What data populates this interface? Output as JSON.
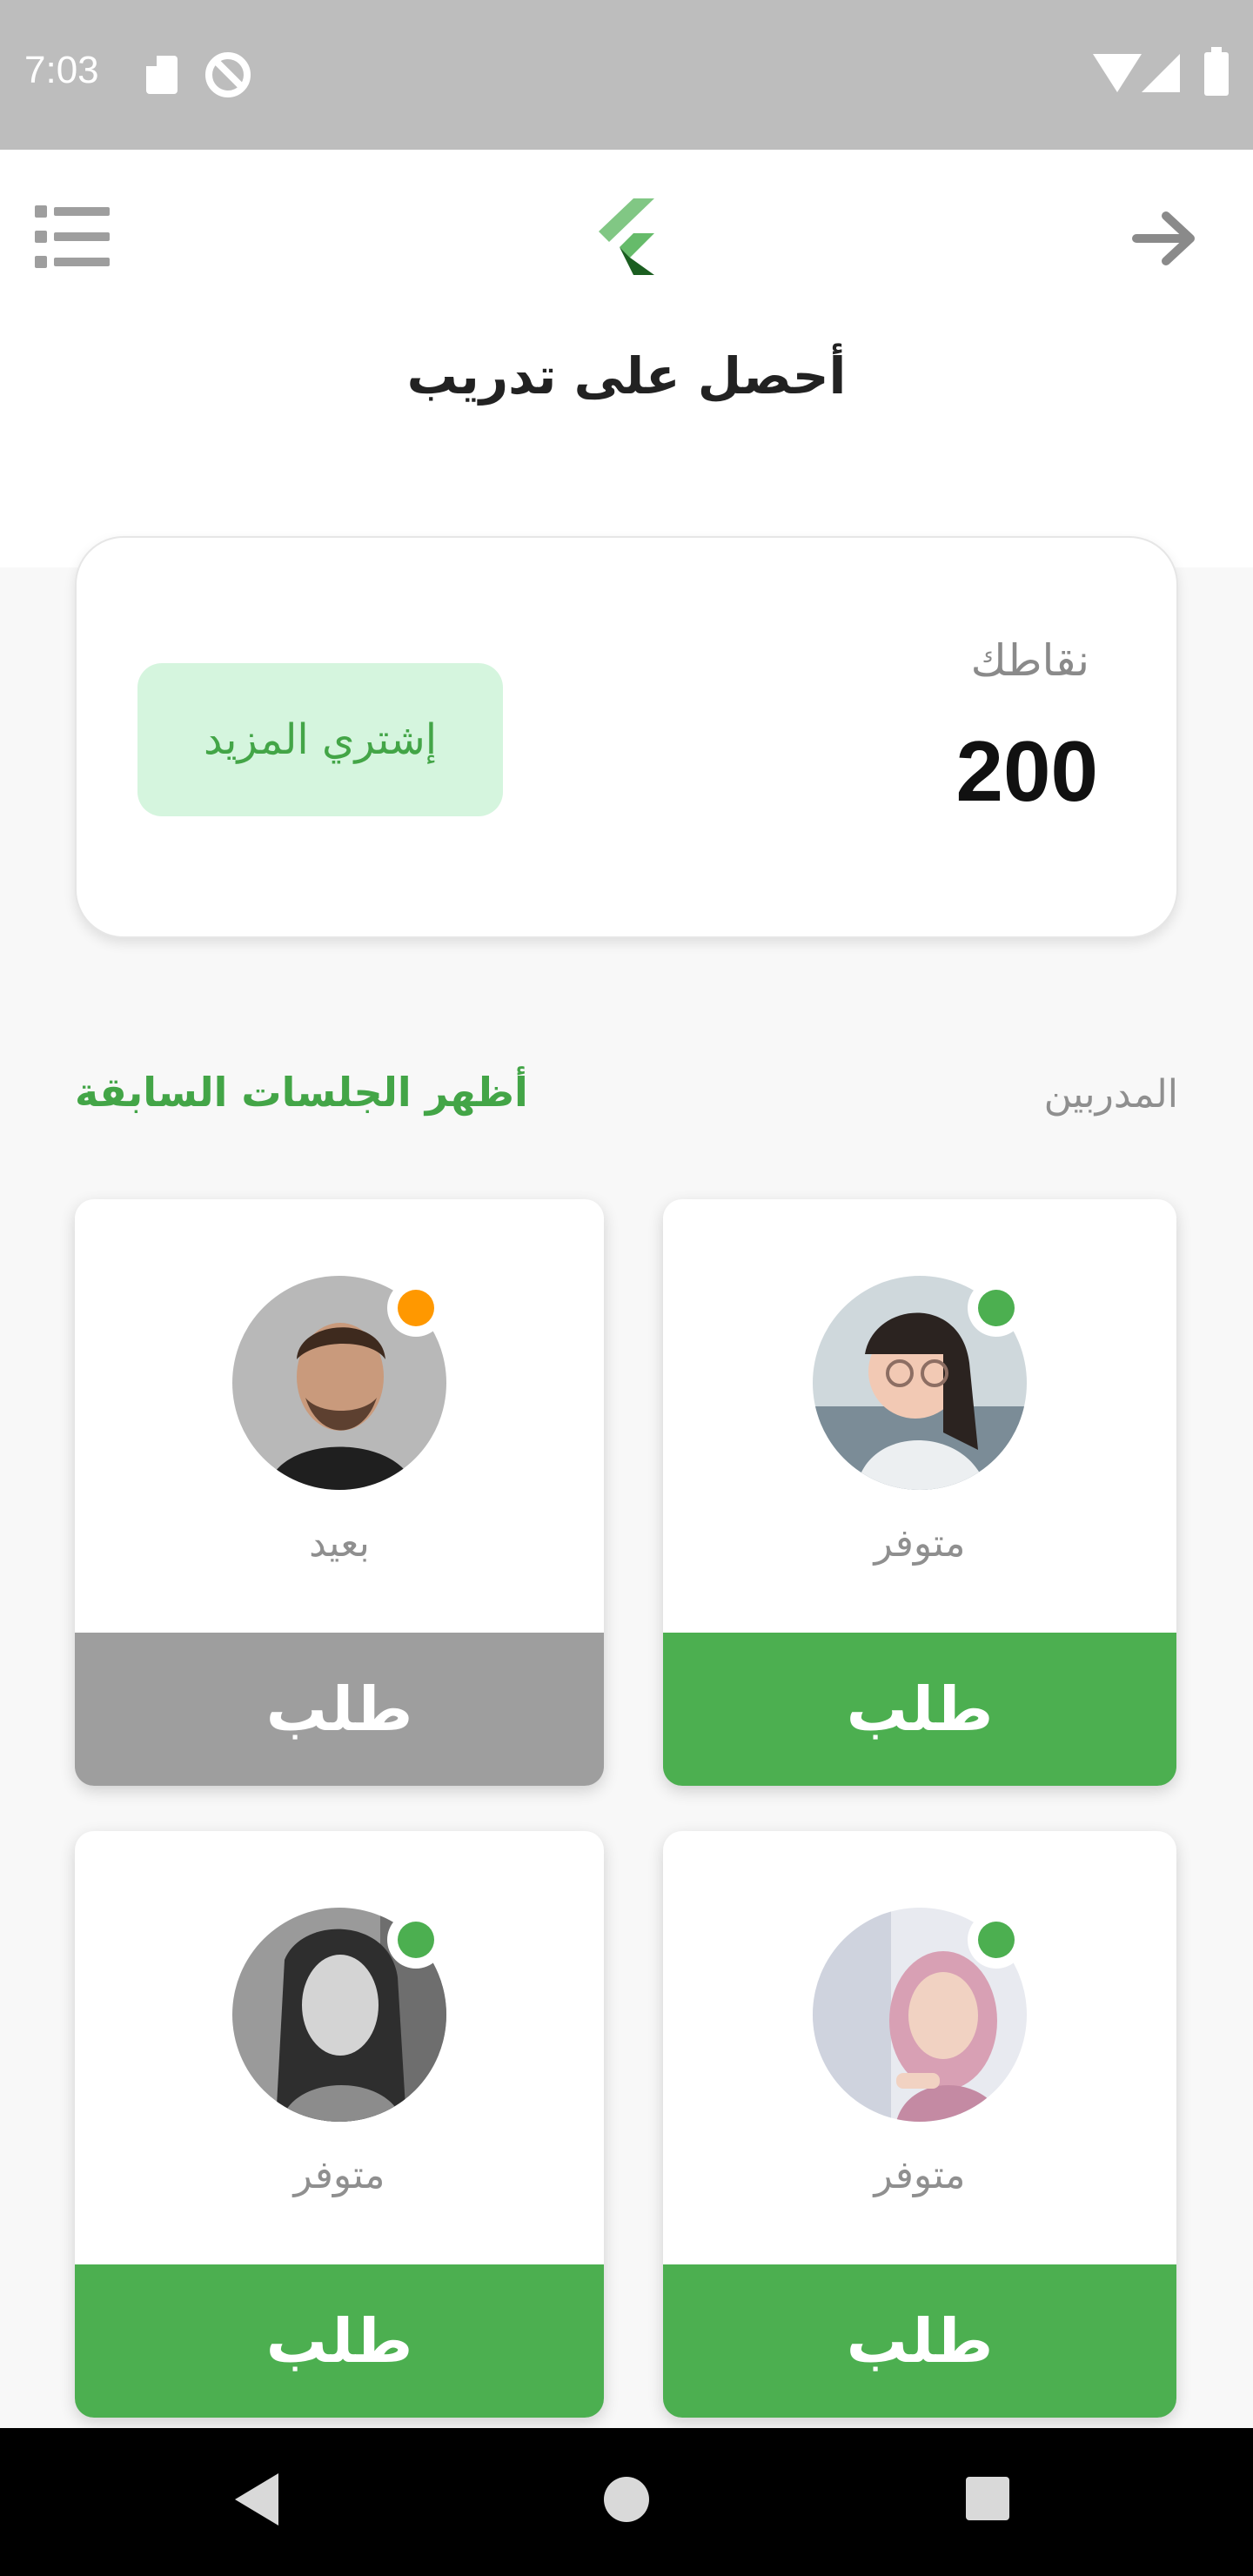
{
  "status_bar": {
    "time": "7:03"
  },
  "app_bar": {
    "title": "أحصل على تدريب"
  },
  "points": {
    "label": "نقاطك",
    "value": "200",
    "buy_label": "إشتري المزيد"
  },
  "section": {
    "title": "المدربين",
    "link": "أظهر الجلسات السابقة"
  },
  "trainers": [
    {
      "status": "متوفر",
      "request_label": "طلب",
      "dot_color": "#4caf50"
    },
    {
      "status": "بعيد",
      "request_label": "طلب",
      "dot_color": "#ff9800"
    },
    {
      "status": "متوفر",
      "request_label": "طلب",
      "dot_color": "#4caf50"
    },
    {
      "status": "متوفر",
      "request_label": "طلب",
      "dot_color": "#4caf50"
    }
  ],
  "colors": {
    "accent": "#4caf50",
    "away": "#ff9800",
    "buy_bg": "#d5f5de",
    "disabled": "#9e9e9e"
  },
  "icons": {
    "menu": "list-menu-icon",
    "logo": "flutter-logo-icon",
    "back": "arrow-right-icon"
  }
}
